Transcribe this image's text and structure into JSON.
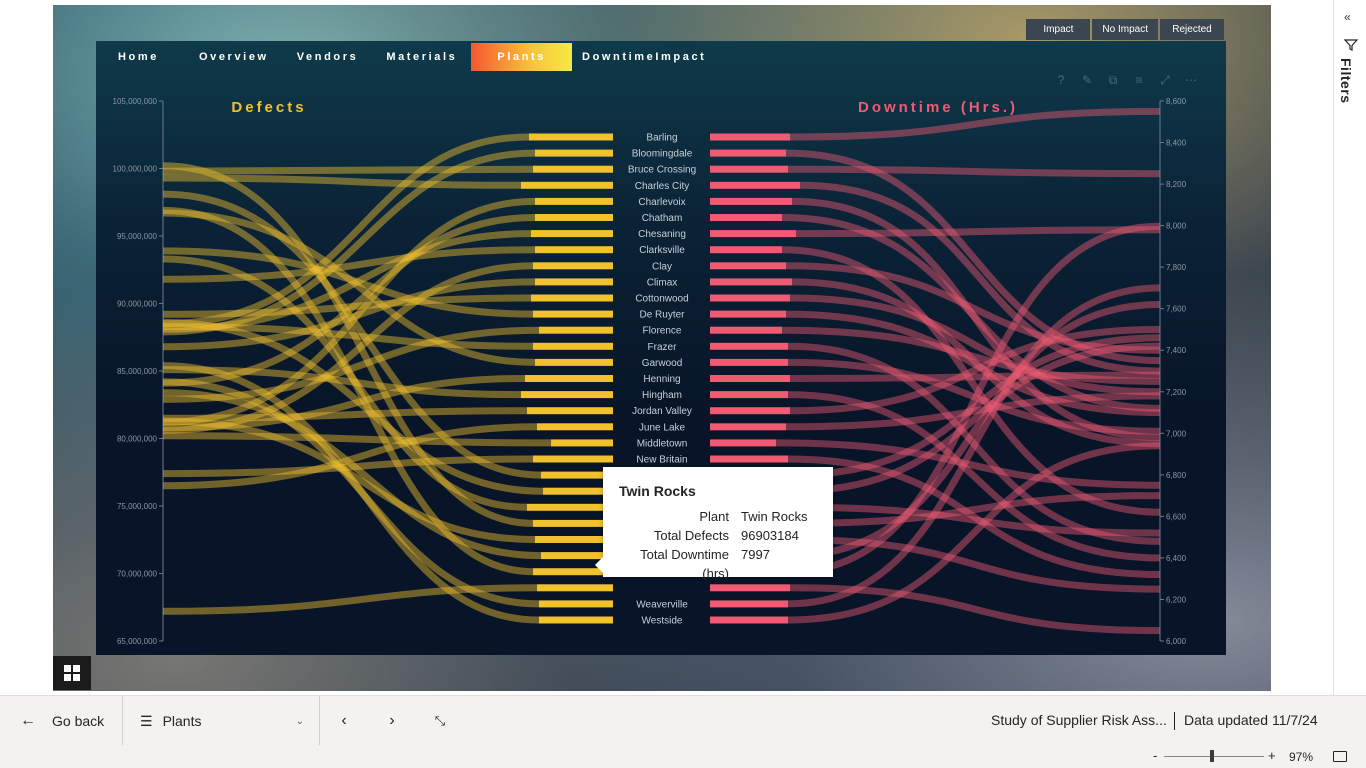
{
  "bookmarks": [
    "Impact",
    "No Impact",
    "Rejected"
  ],
  "nav": {
    "tabs": [
      "Home",
      "Overview",
      "Vendors",
      "Materials",
      "Plants",
      "DowntimeImpact"
    ],
    "active_index": 4
  },
  "colors": {
    "defects": "#f2c12e",
    "downtime": "#f05a73",
    "nav_active_start": "#f7572e",
    "nav_active_end": "#f4ea45"
  },
  "chart_data": {
    "type": "slope",
    "left_title": "Defects",
    "right_title": "Downtime  (Hrs.)",
    "left_axis": {
      "min": 65000000,
      "max": 105000000,
      "ticks": [
        "105,000,000",
        "100,000,000",
        "95,000,000",
        "90,000,000",
        "85,000,000",
        "80,000,000",
        "75,000,000",
        "70,000,000",
        "65,000,000"
      ]
    },
    "right_axis": {
      "min": 6000,
      "max": 8600,
      "ticks": [
        "8,600",
        "8,400",
        "8,200",
        "8,000",
        "7,800",
        "7,600",
        "7,400",
        "7,200",
        "7,000",
        "6,800",
        "6,600",
        "6,400",
        "6,200",
        "6,000"
      ]
    },
    "plants": [
      "Barling",
      "Bloomingdale",
      "Bruce Crossing",
      "Charles City",
      "Charlevoix",
      "Chatham",
      "Chesaning",
      "Clarksville",
      "Clay",
      "Climax",
      "Cottonwood",
      "De Ruyter",
      "Florence",
      "Frazer",
      "Garwood",
      "Henning",
      "Hingham",
      "Jordan Valley",
      "June Lake",
      "Middletown",
      "New Britain",
      "",
      "",
      "",
      "",
      "",
      "",
      "",
      "",
      "Weaverville",
      "Westside"
    ],
    "defects": [
      88500000,
      87900000,
      99800000,
      99300000,
      81200000,
      84100000,
      88100000,
      91800000,
      80600000,
      86800000,
      89200000,
      93900000,
      82900000,
      88300000,
      96700000,
      80800000,
      85100000,
      81500000,
      76500000,
      80200000,
      77400000,
      98100000,
      88600000,
      93300000,
      100200000,
      81300000,
      83400000,
      96900000,
      67200000,
      84200000,
      85400000
    ],
    "downtime": [
      8550,
      7350,
      8250,
      7300,
      6980,
      7120,
      7980,
      6620,
      7400,
      6950,
      7200,
      7100,
      7250,
      6480,
      7010,
      7280,
      6400,
      7500,
      7180,
      6750,
      6320,
      7460,
      7420,
      6520,
      6700,
      6250,
      7620,
      7997,
      6050,
      7700,
      6940
    ],
    "bar_defects": [
      84,
      78,
      80,
      92,
      78,
      78,
      82,
      78,
      80,
      78,
      82,
      80,
      74,
      80,
      78,
      88,
      92,
      86,
      76,
      62,
      80,
      72,
      70,
      86,
      80,
      78,
      72,
      80,
      76,
      74,
      74
    ],
    "bar_downtime": [
      80,
      76,
      78,
      90,
      82,
      72,
      86,
      72,
      76,
      82,
      80,
      76,
      72,
      78,
      78,
      80,
      78,
      80,
      76,
      66,
      78,
      80,
      80,
      80,
      80,
      78,
      80,
      80,
      80,
      78,
      78
    ]
  },
  "tooltip": {
    "title": "Twin Rocks",
    "rows": [
      {
        "key": "Plant",
        "value": "Twin Rocks"
      },
      {
        "key": "Total Defects",
        "value": "96903184"
      },
      {
        "key": "Total Downtime (hrs)",
        "value": "7997"
      }
    ]
  },
  "visual_icons": [
    "help-icon",
    "pin-icon",
    "copy-icon",
    "filter-icon",
    "focus-icon",
    "more-icon"
  ],
  "right_rail": {
    "label": "Filters"
  },
  "footer": {
    "go_back": "Go back",
    "page_select": "Plants",
    "report_name": "Study of Supplier Risk Ass...",
    "data_updated": "Data updated 11/7/24"
  },
  "zoom": {
    "minus": "-",
    "plus": "+",
    "percent": "97%",
    "level": 0.48
  }
}
